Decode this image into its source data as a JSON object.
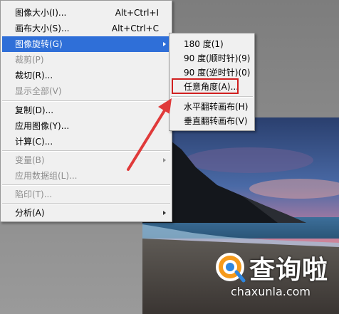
{
  "image_menu": {
    "items": [
      {
        "label": "图像大小(I)...",
        "shortcut": "Alt+Ctrl+I"
      },
      {
        "label": "画布大小(S)...",
        "shortcut": "Alt+Ctrl+C"
      },
      {
        "label": "图像旋转(G)"
      },
      {
        "label": "裁剪(P)"
      },
      {
        "label": "裁切(R)..."
      },
      {
        "label": "显示全部(V)"
      },
      {
        "label": "复制(D)..."
      },
      {
        "label": "应用图像(Y)..."
      },
      {
        "label": "计算(C)..."
      },
      {
        "label": "变量(B)"
      },
      {
        "label": "应用数据组(L)..."
      },
      {
        "label": "陷印(T)..."
      },
      {
        "label": "分析(A)"
      }
    ]
  },
  "rotate_submenu": {
    "items": [
      {
        "label": "180 度(1)"
      },
      {
        "label": "90 度(顺时针)(9)"
      },
      {
        "label": "90 度(逆时针)(0)"
      },
      {
        "label": "任意角度(A)..."
      },
      {
        "label": "水平翻转画布(H)"
      },
      {
        "label": "垂直翻转画布(V)"
      }
    ]
  },
  "colors": {
    "selection": "#2f6fd8",
    "highlight": "#d02020",
    "arrow": "#e03a3a"
  },
  "watermark": {
    "title": "查询啦",
    "domain": "chaxunla.com"
  }
}
